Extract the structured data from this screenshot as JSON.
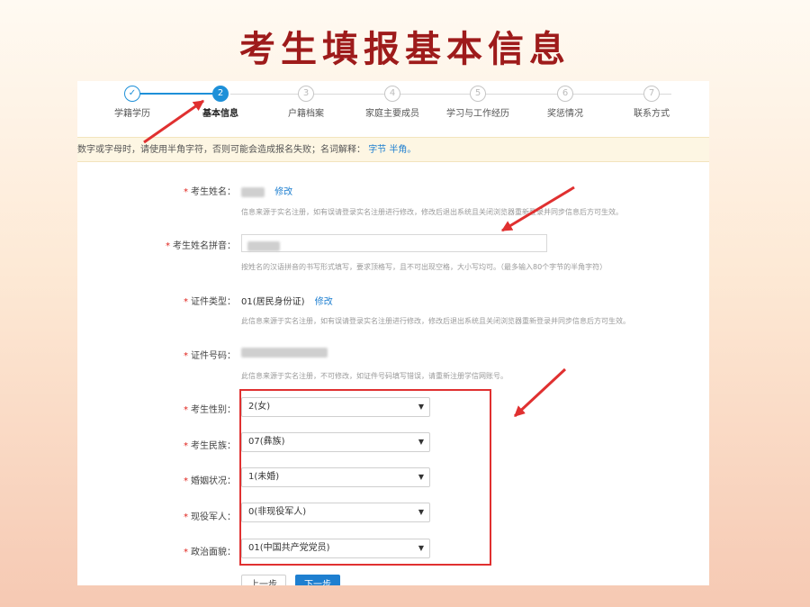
{
  "slide": {
    "title": "考生填报基本信息"
  },
  "stepper": {
    "steps": [
      {
        "num": "✓",
        "label": "学籍学历"
      },
      {
        "num": "2",
        "label": "基本信息"
      },
      {
        "num": "3",
        "label": "户籍档案"
      },
      {
        "num": "4",
        "label": "家庭主要成员"
      },
      {
        "num": "5",
        "label": "学习与工作经历"
      },
      {
        "num": "6",
        "label": "奖惩情况"
      },
      {
        "num": "7",
        "label": "联系方式"
      }
    ]
  },
  "notice": {
    "text": "数字或字母时，请使用半角字符，否则可能会造成报名失败；名词解释：",
    "link1": "字节",
    "link2": "半角。"
  },
  "form": {
    "name": {
      "label": "考生姓名：",
      "edit": "修改",
      "hint": "信息来源于实名注册，如有误请登录实名注册进行修改，修改后退出系统且关闭浏览器重新登录并同步信息后方可生效。"
    },
    "pinyin": {
      "label": "考生姓名拼音：",
      "hint": "按姓名的汉语拼音的书写形式填写，要求顶格写，且不可出现空格，大小写均可。（最多输入80个字节的半角字符）"
    },
    "id_type": {
      "label": "证件类型：",
      "value": "01(居民身份证)",
      "edit": "修改",
      "hint": "此信息来源于实名注册，如有误请登录实名注册进行修改，修改后退出系统且关闭浏览器重新登录并同步信息后方可生效。"
    },
    "id_number": {
      "label": "证件号码：",
      "hint": "此信息来源于实名注册，不可修改，如证件号码填写错误，请重新注册学信网账号。"
    },
    "gender": {
      "label": "考生性别：",
      "value": "2(女)"
    },
    "ethnicity": {
      "label": "考生民族：",
      "value": "07(彝族)"
    },
    "marital": {
      "label": "婚姻状况：",
      "value": "1(未婚)"
    },
    "military": {
      "label": "现役军人：",
      "value": "0(非现役军人)"
    },
    "political": {
      "label": "政治面貌：",
      "value": "01(中国共产党党员)"
    }
  },
  "buttons": {
    "prev": "上一步",
    "next": "下一步"
  },
  "colors": {
    "title": "#9e1b1b",
    "accent": "#1e90d8",
    "highlight": "#e03030"
  }
}
